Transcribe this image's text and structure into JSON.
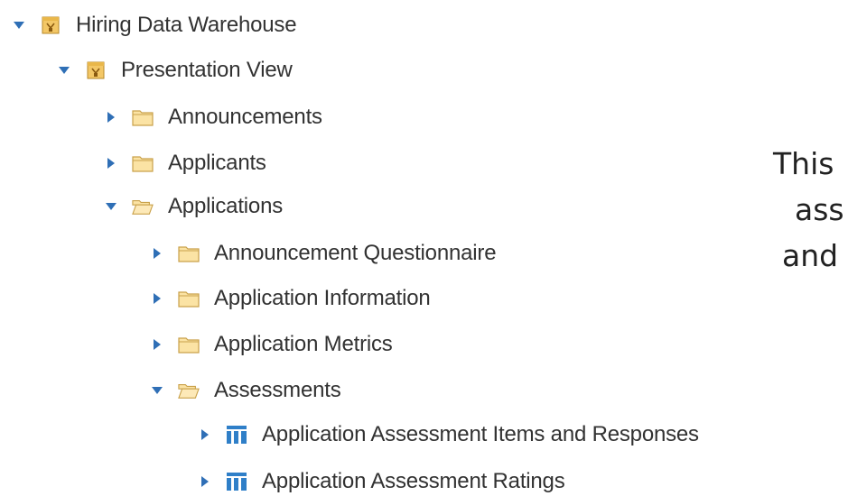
{
  "tree": {
    "root": {
      "label": "Hiring Data Warehouse",
      "expanded": true,
      "icon": "package-icon"
    },
    "presentation_view": {
      "label": "Presentation View",
      "expanded": true,
      "icon": "package-icon"
    },
    "announcements": {
      "label": "Announcements",
      "expanded": false,
      "icon": "folder-closed-icon"
    },
    "applicants": {
      "label": "Applicants",
      "expanded": false,
      "icon": "folder-closed-icon"
    },
    "applications": {
      "label": "Applications",
      "expanded": true,
      "icon": "folder-open-icon"
    },
    "announcement_questionnaire": {
      "label": "Announcement Questionnaire",
      "expanded": false,
      "icon": "folder-closed-icon"
    },
    "application_information": {
      "label": "Application Information",
      "expanded": false,
      "icon": "folder-closed-icon"
    },
    "application_metrics": {
      "label": "Application Metrics",
      "expanded": false,
      "icon": "folder-closed-icon"
    },
    "assessments": {
      "label": "Assessments",
      "expanded": true,
      "icon": "folder-open-icon"
    },
    "app_assessment_items": {
      "label": "Application Assessment Items and Responses",
      "expanded": false,
      "icon": "table-icon"
    },
    "app_assessment_ratings": {
      "label": "Application Assessment Ratings",
      "expanded": false,
      "icon": "table-icon"
    }
  },
  "side_text": {
    "line1": "This",
    "line2": "ass",
    "line3": "and"
  },
  "colors": {
    "twisty": "#2f6fb6",
    "folder_fill": "#fbe3a4",
    "folder_stroke": "#c9a14a",
    "table_blue": "#2f7fc8",
    "package_fill": "#f3c766"
  }
}
